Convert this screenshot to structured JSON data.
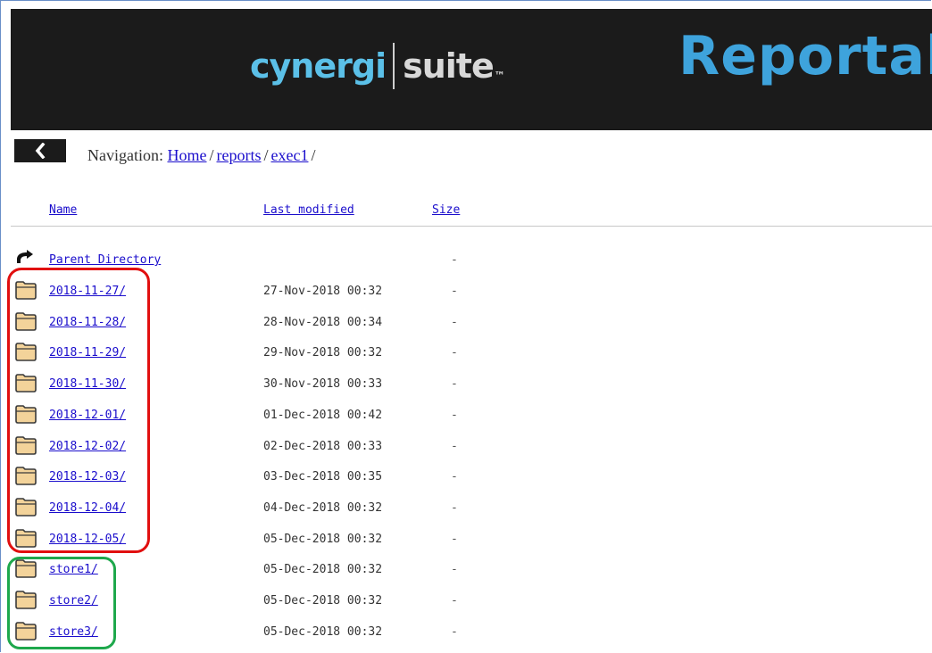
{
  "header": {
    "logo_primary": "cynergi",
    "logo_secondary": "suite",
    "logo_mark": "™",
    "title": "Reportal"
  },
  "back_button": {
    "icon": "chevron-left-icon",
    "glyph": "❮"
  },
  "navigation": {
    "label": "Navigation:",
    "crumbs": [
      "Home",
      "reports",
      "exec1"
    ],
    "separator": "/"
  },
  "table": {
    "columns": {
      "name": "Name",
      "last_modified": "Last modified",
      "size": "Size"
    },
    "parent": {
      "name": "Parent Directory",
      "modified": "",
      "size": "-",
      "icon": "back-arrow-icon"
    },
    "rows": [
      {
        "name": "2018-11-27/",
        "modified": "27-Nov-2018 00:32",
        "size": "-",
        "icon": "folder-icon"
      },
      {
        "name": "2018-11-28/",
        "modified": "28-Nov-2018 00:34",
        "size": "-",
        "icon": "folder-icon"
      },
      {
        "name": "2018-11-29/",
        "modified": "29-Nov-2018 00:32",
        "size": "-",
        "icon": "folder-icon"
      },
      {
        "name": "2018-11-30/",
        "modified": "30-Nov-2018 00:33",
        "size": "-",
        "icon": "folder-icon"
      },
      {
        "name": "2018-12-01/",
        "modified": "01-Dec-2018 00:42",
        "size": "-",
        "icon": "folder-icon"
      },
      {
        "name": "2018-12-02/",
        "modified": "02-Dec-2018 00:33",
        "size": "-",
        "icon": "folder-icon"
      },
      {
        "name": "2018-12-03/",
        "modified": "03-Dec-2018 00:35",
        "size": "-",
        "icon": "folder-icon"
      },
      {
        "name": "2018-12-04/",
        "modified": "04-Dec-2018 00:32",
        "size": "-",
        "icon": "folder-icon"
      },
      {
        "name": "2018-12-05/",
        "modified": "05-Dec-2018 00:32",
        "size": "-",
        "icon": "folder-icon"
      },
      {
        "name": "store1/",
        "modified": "05-Dec-2018 00:32",
        "size": "-",
        "icon": "folder-icon"
      },
      {
        "name": "store2/",
        "modified": "05-Dec-2018 00:32",
        "size": "-",
        "icon": "folder-icon"
      },
      {
        "name": "store3/",
        "modified": "05-Dec-2018 00:32",
        "size": "-",
        "icon": "folder-icon"
      }
    ]
  },
  "colors": {
    "header_bg": "#1b1b1b",
    "logo_accent": "#5bc0e8",
    "title_blue": "#3ea3dc",
    "link_blue": "#1a0dcc",
    "highlight_red": "#e10f0f",
    "highlight_green": "#1ea84c",
    "folder_fill": "#f3d39a"
  }
}
